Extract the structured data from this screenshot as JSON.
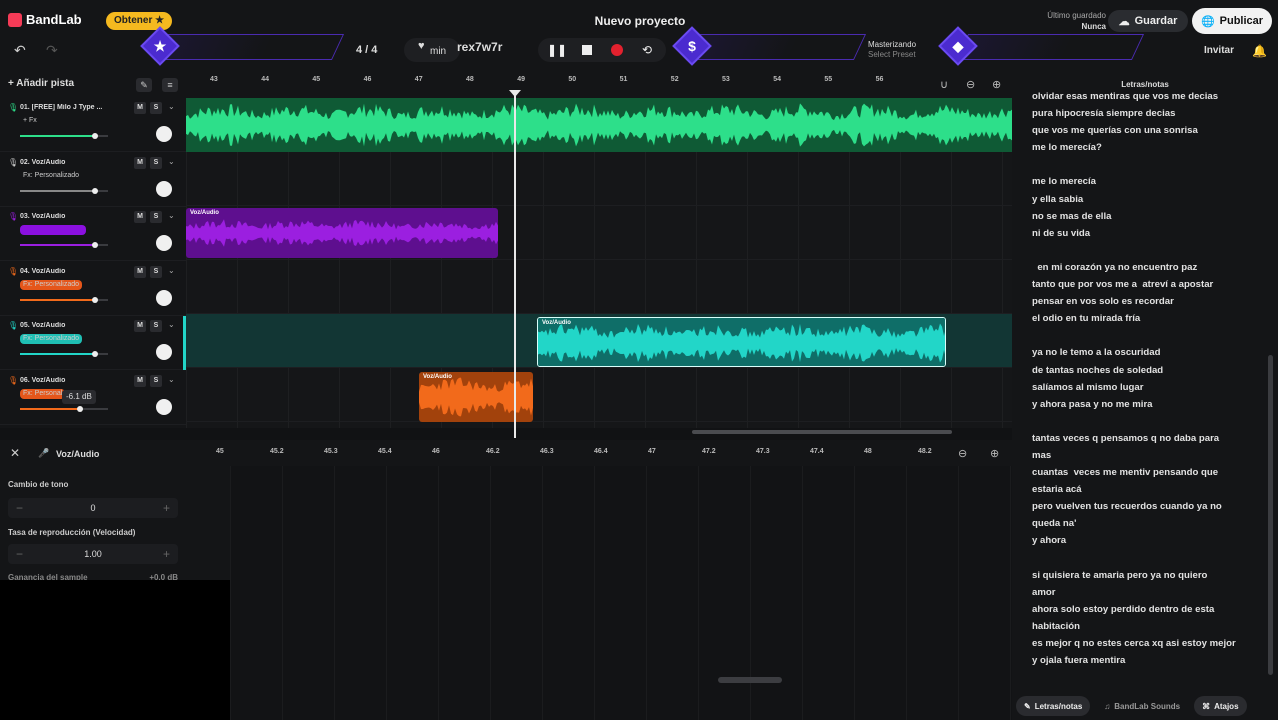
{
  "header": {
    "brand": "BandLab",
    "get_label": "Obtener",
    "project_title": "Nuevo proyecto",
    "last_saved_label": "Último guardado",
    "last_saved_value": "Nunca",
    "save_label": "Guardar",
    "publish_label": "Publicar",
    "invite_label": "Invitar",
    "time_signature": "4 / 4",
    "tempo_unit": "min",
    "key_name": "rex7w7r",
    "mastering_label": "Masterizando",
    "mastering_preset": "Select Preset",
    "icons": {
      "undo": "undo-icon",
      "redo": "redo-icon",
      "star": "star-icon",
      "dollar": "dollar-icon",
      "diamond": "diamond-icon",
      "bell": "bell-icon"
    }
  },
  "tracks_panel": {
    "add_track": "+ Añadir pista",
    "tracks": [
      {
        "name": "01. [FREE] Milo J Type ...",
        "fx": "+ Fx",
        "color": "#2ddf8a",
        "fx_bg": "transparent",
        "volume": 0.85
      },
      {
        "name": "02. Voz/Audio",
        "fx": "Fx: Personalizado",
        "color": "#cccccc",
        "fx_bg": "transparent",
        "volume": 0.85
      },
      {
        "name": "03. Voz/Audio",
        "fx": "",
        "color": "#9b1fe0",
        "fx_bg": "#8b10e0",
        "volume": 0.85
      },
      {
        "name": "04. Voz/Audio",
        "fx": "Fx: Personalizado",
        "color": "#f26a1b",
        "fx_bg": "#e5561a",
        "volume": 0.85
      },
      {
        "name": "05. Voz/Audio",
        "fx": "Fx: Personalizado",
        "color": "#22d6c8",
        "fx_bg": "#1fbfb4",
        "volume": 0.85
      },
      {
        "name": "06. Voz/Audio",
        "fx": "Fx: Personal",
        "color": "#f26a1b",
        "fx_bg": "#e5561a",
        "volume": 0.68
      }
    ],
    "tooltip_db": "-6.1 dB",
    "mute": "M",
    "solo": "S"
  },
  "ruler": {
    "ticks": [
      "43",
      "44",
      "45",
      "46",
      "47",
      "48",
      "49",
      "50",
      "51",
      "52",
      "53",
      "54",
      "55",
      "56"
    ]
  },
  "clips": [
    {
      "label": "Voz/Audio",
      "color": "#9b1fe0",
      "bg": "#5e0f8f"
    },
    {
      "label": "Voz/Audio",
      "color": "#22d6c8",
      "bg": "#0f6e68"
    },
    {
      "label": "Voz/Audio",
      "color": "#f26a1b",
      "bg": "#a2420c"
    }
  ],
  "editor": {
    "title": "Voz/Audio",
    "pitch_label": "Cambio de tono",
    "pitch_value": "0",
    "rate_label": "Tasa de reproducción (Velocidad)",
    "rate_value": "1.00",
    "gain_label": "Ganancia del sample",
    "gain_value": "+0.0 dB",
    "ticks": [
      "45",
      "45.2",
      "45.3",
      "45.4",
      "46",
      "46.2",
      "46.3",
      "46.4",
      "47",
      "47.2",
      "47.3",
      "47.4",
      "48",
      "48.2"
    ]
  },
  "lyrics": {
    "title": "Letras/notas",
    "lines": [
      "olvidar esas mentiras que vos me decias",
      "pura hipocresía siempre decias",
      "que vos me querías con una sonrisa",
      "me lo merecía?",
      "",
      "me lo merecía",
      "y ella sabia",
      "no se mas de ella",
      "ni de su vida",
      "",
      "  en mi corazón ya no encuentro paz",
      "tanto que por vos me a  atreví a apostar",
      "pensar en vos solo es recordar",
      "el odio en tu mirada fría",
      "",
      "ya no le temo a la oscuridad",
      "de tantas noches de soledad",
      "salíamos al mismo lugar",
      "y ahora pasa y no me mira",
      "",
      "tantas veces q pensamos q no daba para",
      "mas",
      "cuantas  veces me mentiv pensando que",
      "estaria acá",
      "pero vuelven tus recuerdos cuando ya no",
      "queda na'",
      "y ahora",
      "",
      "si quisiera te amaria pero ya no quiero",
      "amor",
      "ahora solo estoy perdido dentro de esta",
      "habitación",
      "es mejor q no estes cerca xq asi estoy mejor",
      "y ojala fuera mentira"
    ],
    "tabs": [
      "Letras/notas",
      "BandLab Sounds",
      "Atajos"
    ]
  }
}
